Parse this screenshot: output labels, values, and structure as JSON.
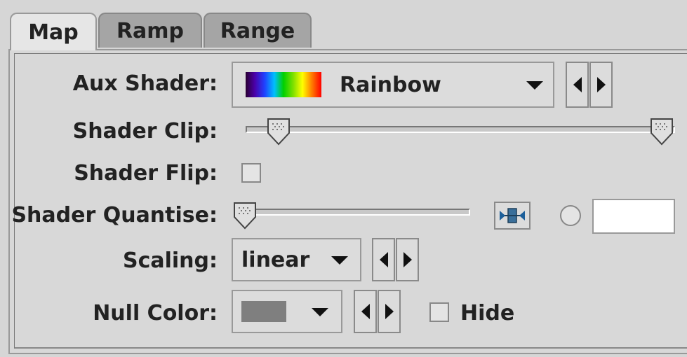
{
  "tabs": [
    {
      "label": "Map",
      "active": true
    },
    {
      "label": "Ramp",
      "active": false
    },
    {
      "label": "Range",
      "active": false
    }
  ],
  "aux_shader": {
    "label": "Aux Shader:",
    "value": "Rainbow",
    "icon": "rainbow-swatch"
  },
  "shader_clip": {
    "label": "Shader Clip:",
    "low": 0.05,
    "high": 1.0
  },
  "shader_flip": {
    "label": "Shader Flip:",
    "checked": false
  },
  "shader_quantise": {
    "label": "Shader Quantise:",
    "level": 0.0,
    "field_value": "",
    "radio_selected": false,
    "icon": "quantise-icon"
  },
  "scaling": {
    "label": "Scaling:",
    "value": "linear"
  },
  "null_color": {
    "label": "Null Color:",
    "swatch_color": "#7f7f7f"
  },
  "hide": {
    "label": "Hide",
    "checked": false
  },
  "colors": {
    "background": "#d6d6d6",
    "active_tab": "#e6e6e6",
    "inactive_tab": "#a5a5a5"
  }
}
